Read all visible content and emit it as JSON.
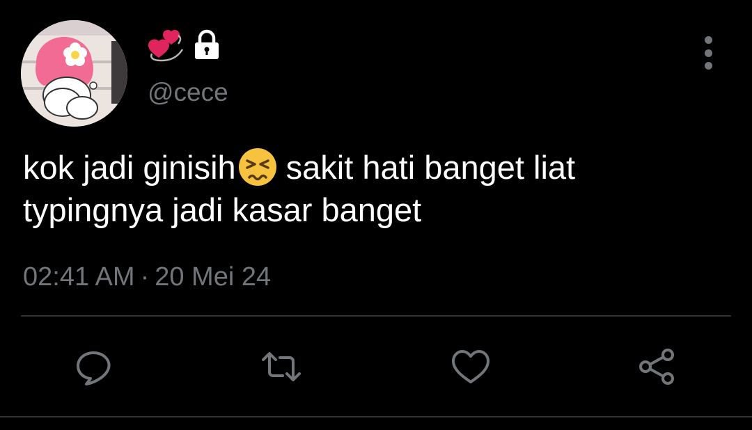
{
  "tweet": {
    "display_name_icons": [
      "revolving-hearts-icon",
      "lock-icon"
    ],
    "handle": "@cece",
    "text_line1_before_emoji": "kok jadi ginisih",
    "text_emoji": "persevering-face-emoji",
    "text_line1_after_emoji": "sakit hati banget liat",
    "text_line2": "typingnya jadi kasar banget",
    "time": "02:41 AM",
    "separator": "·",
    "date": "20 Mei 24"
  },
  "actions": [
    "reply-icon",
    "retweet-icon",
    "like-icon",
    "share-icon"
  ],
  "colors": {
    "background": "#000000",
    "text": "#ffffff",
    "secondary_text": "#72767b",
    "divider": "#2f3336"
  }
}
